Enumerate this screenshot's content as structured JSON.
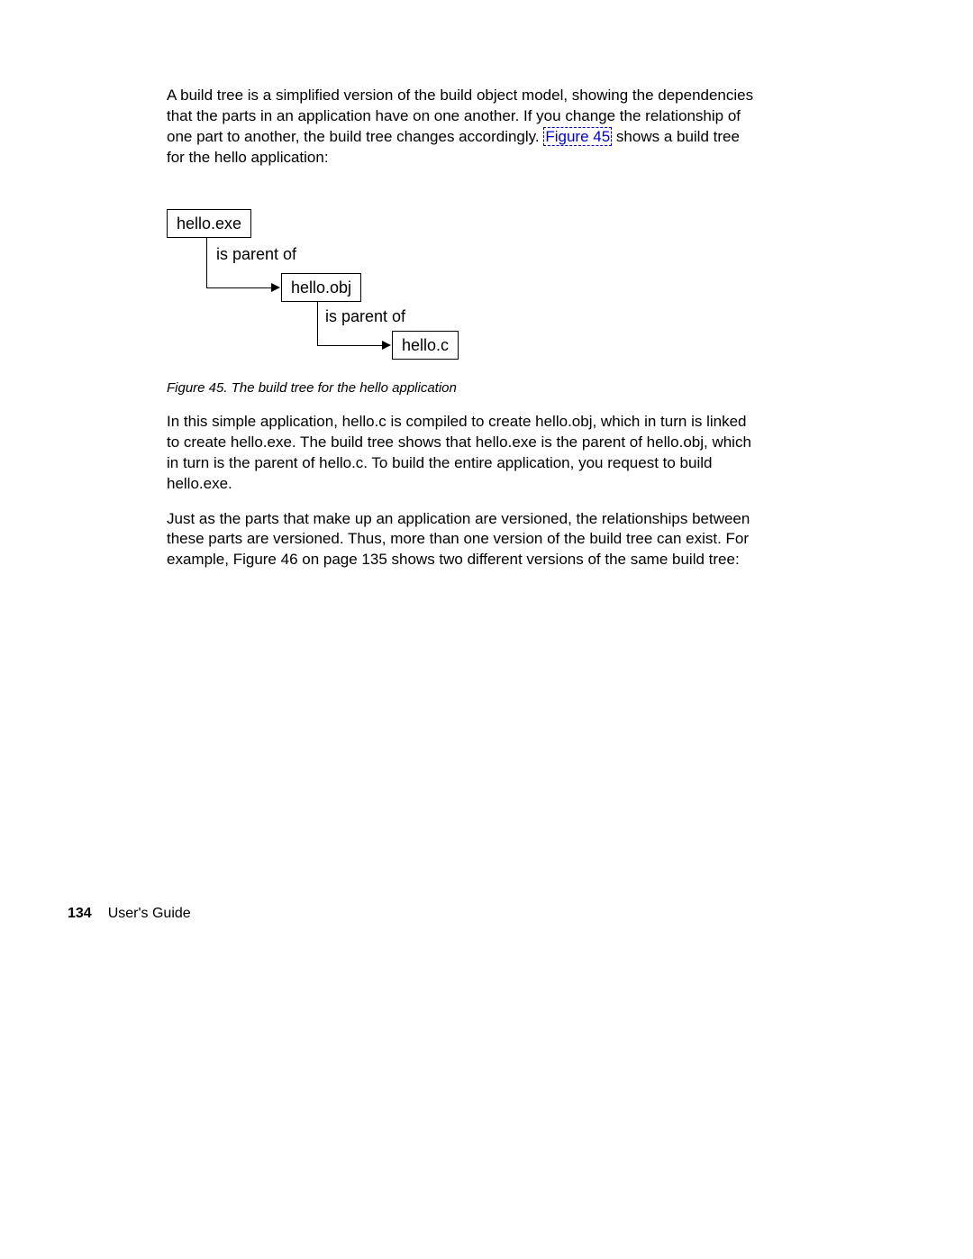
{
  "paragraphs": {
    "p1_before": "A build tree is a simplified version of the build object model, showing the dependencies that the parts in an application have on one another. If you change the relationship of one part to another, the build tree changes accordingly. ",
    "p1_link": "Figure 45",
    "p1_after": " shows a build tree for the hello application:",
    "p2": "In this simple application, hello.c is compiled to create hello.obj, which in turn is linked to create hello.exe. The build tree shows that hello.exe is the parent of hello.obj, which in turn is the parent of hello.c. To build the entire application, you request to build hello.exe.",
    "p3": "Just as the parts that make up an application are versioned, the relationships between these parts are versioned. Thus, more than one version of the build tree can exist. For example, Figure 46 on page 135  shows two different versions of the same build tree:"
  },
  "diagram": {
    "box1": "hello.exe",
    "label1": "is parent of",
    "box2": "hello.obj",
    "label2": "is parent of",
    "box3": "hello.c"
  },
  "caption": "Figure 45. The build tree for the hello application",
  "footer": {
    "page": "134",
    "title": "User's Guide"
  },
  "chart_data": {
    "type": "table",
    "title": "Build tree for the hello application",
    "nodes": [
      {
        "name": "hello.exe",
        "parent": null
      },
      {
        "name": "hello.obj",
        "parent": "hello.exe"
      },
      {
        "name": "hello.c",
        "parent": "hello.obj"
      }
    ],
    "relationship_label": "is parent of"
  }
}
